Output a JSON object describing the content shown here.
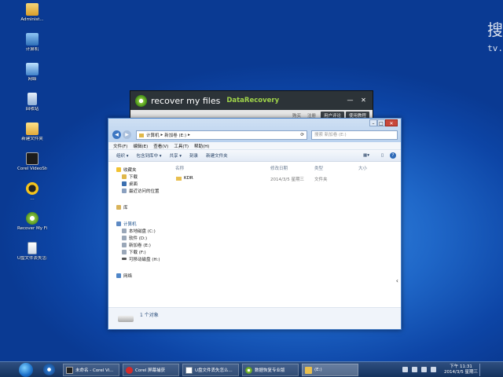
{
  "desktop": {
    "icons": [
      {
        "label": "Administ...",
        "icon": "user-folder-icon"
      },
      {
        "label": "计算机",
        "icon": "computer-icon"
      },
      {
        "label": "网络",
        "icon": "network-icon"
      },
      {
        "label": "回收站",
        "icon": "recycle-bin-icon"
      },
      {
        "label": "新建文件夹",
        "icon": "folder-icon"
      },
      {
        "label": "Corel VideoStudi...",
        "icon": "corel-icon"
      },
      {
        "label": "…",
        "icon": "qq-icon"
      },
      {
        "label": "Recover My Files",
        "icon": "recover-icon"
      },
      {
        "label": "U盘文件丢失怎么办...",
        "icon": "document-icon"
      }
    ],
    "watermark": {
      "text": "搜",
      "sub": "tv."
    }
  },
  "recover_window": {
    "title": "recover my files",
    "subtitle": "DataRecovery",
    "minimize": "—",
    "close": "✕",
    "links": [
      "购买",
      "注册"
    ],
    "buttons": [
      "用户评论",
      "使用教程"
    ]
  },
  "explorer": {
    "address": [
      "计算机",
      "新加卷 (E:)"
    ],
    "search_placeholder": "搜索 新加卷 (E:)",
    "menu": [
      "文件(F)",
      "编辑(E)",
      "查看(V)",
      "工具(T)",
      "帮助(H)"
    ],
    "toolbar": [
      "组织 ▾",
      "包含到库中 ▾",
      "共享 ▾",
      "刻录",
      "新建文件夹"
    ],
    "nav": {
      "favorites": "收藏夹",
      "favorites_items": [
        "下载",
        "桌面",
        "最近访问的位置"
      ],
      "library": "库",
      "computer": "计算机",
      "drives": [
        "本地磁盘 (C:)",
        "软件 (D:)",
        "新加卷 (E:)",
        "下载 (F:)",
        "可移动磁盘 (H:)"
      ],
      "network": "网络"
    },
    "columns": [
      "名称",
      "修改日期",
      "类型",
      "大小"
    ],
    "files": [
      {
        "name": "KDR",
        "date": "2014/3/5 星期三",
        "type": "文件夹",
        "size": ""
      }
    ],
    "status": "1 个对象"
  },
  "taskbar": {
    "items": [
      "未命名 - Corel Vi...",
      "Corel 屏幕捕获",
      "U盘文件丢失怎么...",
      "数据恢复专业版",
      "(E:)"
    ],
    "time": "下午 11:31",
    "date": "2014/3/5 星期三"
  },
  "colors": {
    "accent": "#9fd34a",
    "taskbar": "#1f3d6b",
    "desktop": "#1f67c8"
  }
}
